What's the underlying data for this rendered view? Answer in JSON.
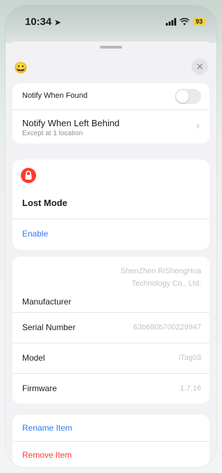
{
  "status": {
    "time": "10:34",
    "battery": "93"
  },
  "header": {
    "emoji": "😀",
    "close": "✕"
  },
  "notify": {
    "found_label": "Notify When Found",
    "left_behind_label": "Notify When Left Behind",
    "left_behind_sub": "Except at 1 location"
  },
  "lost_mode": {
    "title": "Lost Mode",
    "enable": "Enable"
  },
  "details": {
    "manufacturer_label": "Manufacturer",
    "manufacturer_value": "ShenZhen RiShengHua Technology Co., Ltd.",
    "serial_label": "Serial Number",
    "serial_value": "63b680b700229947",
    "model_label": "Model",
    "model_value": "iTag03",
    "firmware_label": "Firmware",
    "firmware_value": "1.7.16"
  },
  "actions": {
    "rename": "Rename Item",
    "remove": "Remove Item"
  }
}
